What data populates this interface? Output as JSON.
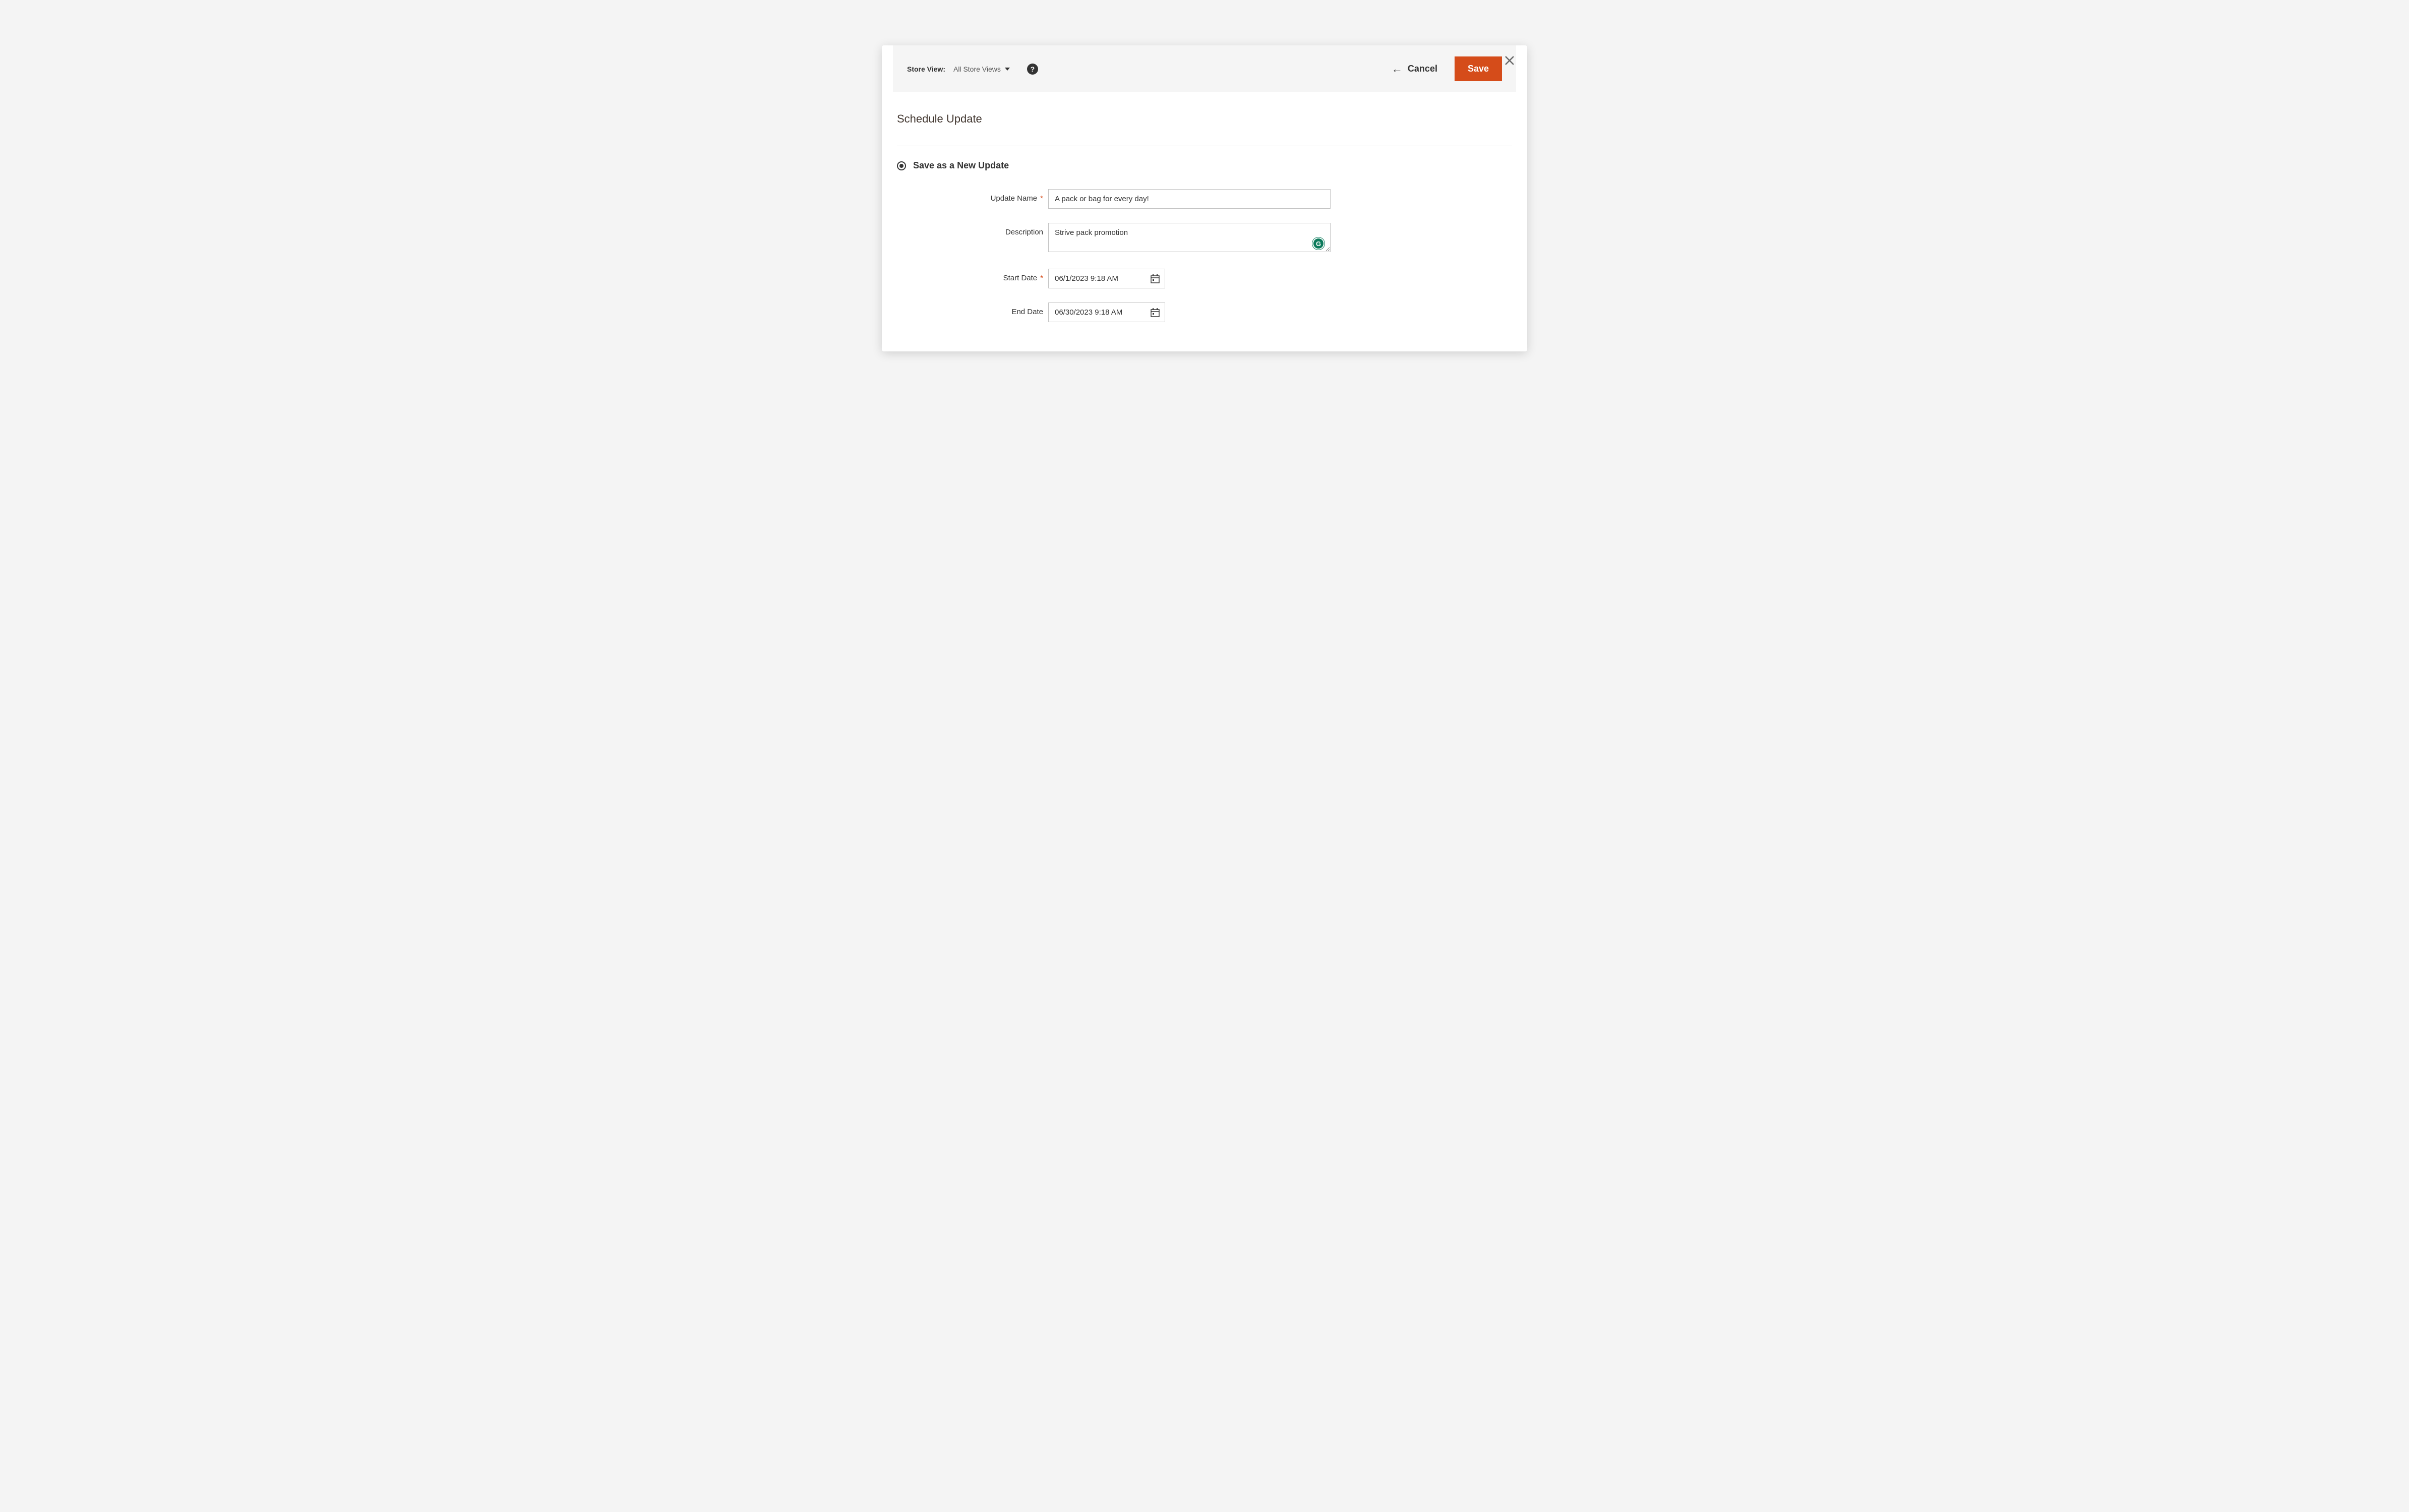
{
  "toolbar": {
    "store_view_label": "Store View:",
    "store_view_value": "All Store Views",
    "cancel_label": "Cancel",
    "save_label": "Save"
  },
  "section": {
    "title": "Schedule Update"
  },
  "radio": {
    "save_as_new_label": "Save as a New Update"
  },
  "fields": {
    "update_name_label": "Update Name",
    "update_name_value": "A pack or bag for every day!",
    "description_label": "Description",
    "description_value": "Strive pack promotion",
    "start_date_label": "Start Date",
    "start_date_value": "06/1/2023 9:18 AM",
    "end_date_label": "End Date",
    "end_date_value": "06/30/2023 9:18 AM"
  },
  "icons": {
    "grammarly_letter": "G",
    "help_letter": "?"
  }
}
